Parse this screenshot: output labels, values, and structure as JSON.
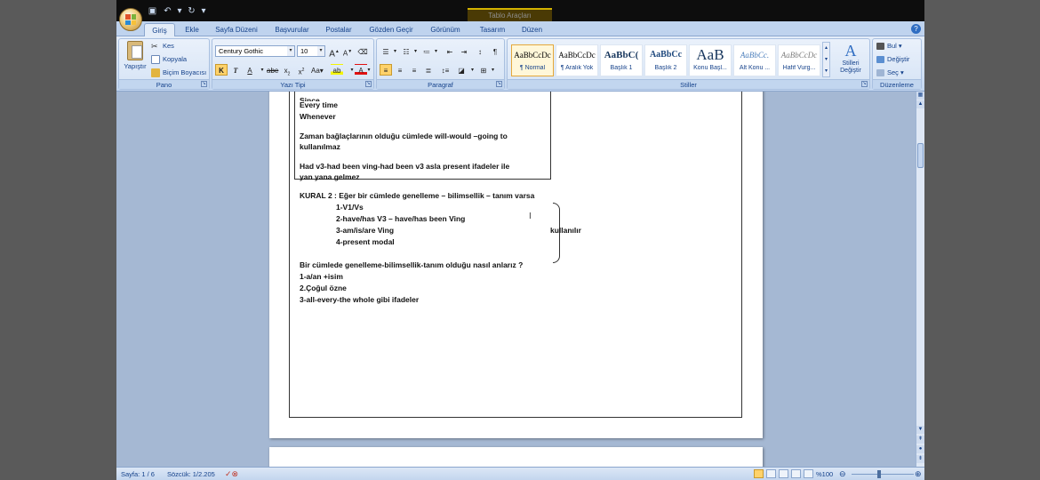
{
  "window": {
    "context_tab_title": "Tablo Araçları"
  },
  "quick_access": {
    "icons": [
      "save-icon",
      "undo-icon",
      "redo-icon",
      "customize-icon"
    ]
  },
  "tabs": [
    "Giriş",
    "Ekle",
    "Sayfa Düzeni",
    "Başvurular",
    "Postalar",
    "Gözden Geçir",
    "Görünüm",
    "Tasarım",
    "Düzen"
  ],
  "active_tab": "Giriş",
  "ribbon": {
    "pano": {
      "label": "Pano",
      "paste": "Yapıştır",
      "cut": "Kes",
      "copy": "Kopyala",
      "format_painter": "Biçim Boyacısı"
    },
    "font": {
      "label": "Yazı Tipi",
      "family": "Century Gothic",
      "size": "10"
    },
    "paragraph": {
      "label": "Paragraf"
    },
    "styles": {
      "label": "Stiller",
      "tiles": [
        {
          "preview": "AaBbCcDc",
          "name": "¶ Normal"
        },
        {
          "preview": "AaBbCcDc",
          "name": "¶ Aralık Yok"
        },
        {
          "preview": "AaBbC(",
          "name": "Başlık 1"
        },
        {
          "preview": "AaBbCc",
          "name": "Başlık 2"
        },
        {
          "preview": "AaB",
          "name": "Konu Başl..."
        },
        {
          "preview": "AaBbCc.",
          "name": "Alt Konu ..."
        },
        {
          "preview": "AaBbCcDc",
          "name": "Hafif Vurg..."
        }
      ],
      "change_styles": "Stilleri Değiştir"
    },
    "editing": {
      "label": "Düzenleme",
      "find": "Bul",
      "replace": "Değiştir",
      "select": "Seç"
    }
  },
  "document": {
    "inner_table": [
      "Every time",
      "Whenever",
      "Zaman bağlaçlarının olduğu cümlede will-would –going to",
      "kullanılmaz",
      "Had v3-had been ving-had been v3 asla present ifadeler ile",
      "yan yana gelmez"
    ],
    "rule_title": "KURAL 2 : Eğer bir cümlede genelleme – bilimsellik – tanım varsa",
    "rule_items": [
      "1-V1/Vs",
      "2-have/has V3 – have/has been Ving",
      "3-am/is/are Ving",
      "4-present modal"
    ],
    "brace_label": "kullanılır",
    "question": "Bir cümlede genelleme-bilimsellik-tanım olduğu nasıl anlarız ?",
    "answers": [
      "1-a/an +isim",
      "2.Çoğul özne",
      "3-all-every-the whole gibi ifadeler"
    ]
  },
  "statusbar": {
    "page": "Sayfa: 1 / 6",
    "words": "Sözcük: 1/2.205",
    "zoom": "%100"
  }
}
